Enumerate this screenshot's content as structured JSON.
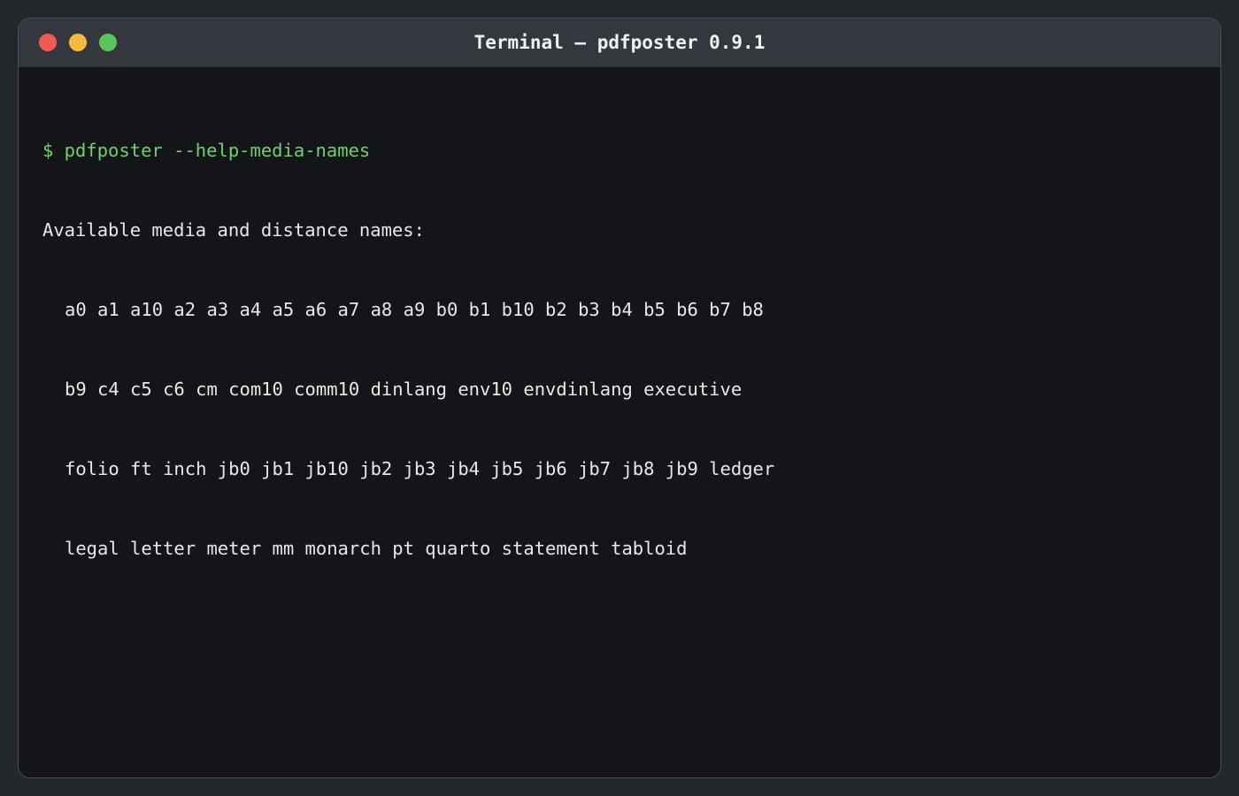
{
  "window": {
    "title": "Terminal — pdfposter 0.9.1",
    "traffic_lights": [
      "close",
      "minimize",
      "zoom"
    ],
    "colors": {
      "close": "#ee5b55",
      "minimize": "#f5bb3e",
      "zoom": "#5bc65b",
      "prompt": "#6ed26e",
      "text": "#e8e8e8",
      "background": "#141518"
    }
  },
  "terminal": {
    "command": "$ pdfposter --help-media-names",
    "output_header": "Available media and distance names:",
    "output_lines": [
      "a0 a1 a10 a2 a3 a4 a5 a6 a7 a8 a9 b0 b1 b10 b2 b3 b4 b5 b6 b7 b8",
      "b9 c4 c5 c6 cm com10 comm10 dinlang env10 envdinlang executive",
      "folio ft inch jb0 jb1 jb10 jb2 jb3 jb4 jb5 jb6 jb7 jb8 jb9 ledger",
      "legal letter meter mm monarch pt quarto statement tabloid"
    ]
  }
}
